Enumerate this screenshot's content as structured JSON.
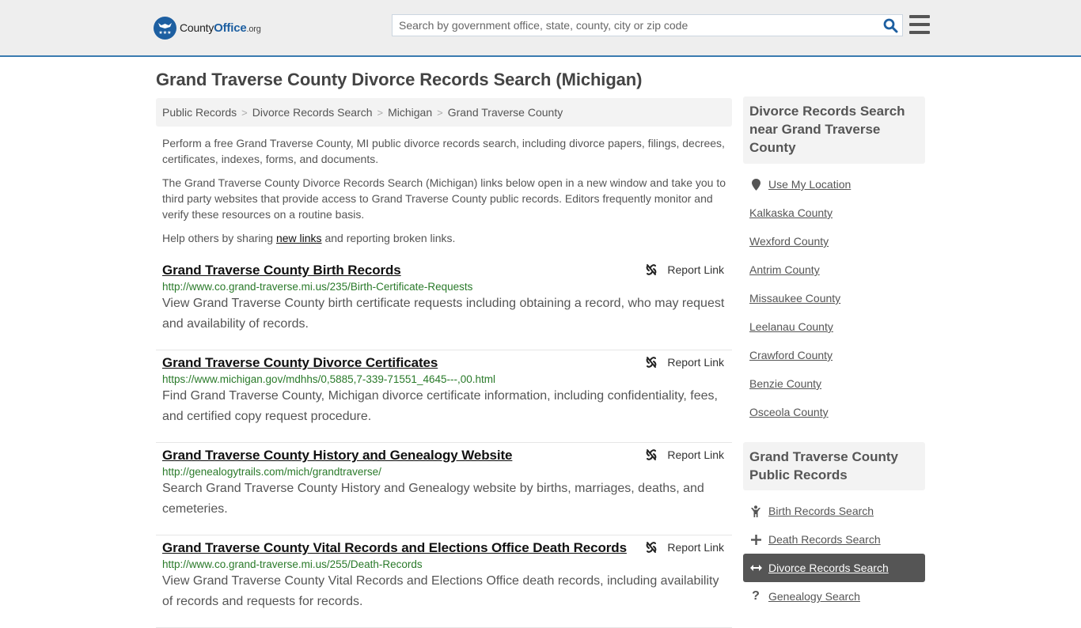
{
  "header": {
    "logo": {
      "name_part1": "County",
      "name_part2": "Office",
      "tld": ".org"
    },
    "search": {
      "placeholder": "Search by government office, state, county, city or zip code",
      "value": ""
    },
    "icons": {
      "search": "search-icon",
      "menu": "hamburger-menu-icon"
    }
  },
  "main": {
    "title": "Grand Traverse County Divorce Records Search (Michigan)",
    "breadcrumb": [
      "Public Records",
      "Divorce Records Search",
      "Michigan",
      "Grand Traverse County"
    ],
    "intro": {
      "p1": "Perform a free Grand Traverse County, MI public divorce records search, including divorce papers, filings, decrees, certificates, indexes, forms, and documents.",
      "p2": "The Grand Traverse County Divorce Records Search (Michigan) links below open in a new window and take you to third party websites that provide access to Grand Traverse County public records. Editors frequently monitor and verify these resources on a routine basis.",
      "p3_before": "Help others by sharing ",
      "p3_link": "new links",
      "p3_after": " and reporting broken links."
    },
    "report_label": "Report Link",
    "results": [
      {
        "title": "Grand Traverse County Birth Records",
        "url": "http://www.co.grand-traverse.mi.us/235/Birth-Certificate-Requests",
        "description": "View Grand Traverse County birth certificate requests including obtaining a record, who may request and availability of records."
      },
      {
        "title": "Grand Traverse County Divorce Certificates",
        "url": "https://www.michigan.gov/mdhhs/0,5885,7-339-71551_4645---,00.html",
        "description": "Find Grand Traverse County, Michigan divorce certificate information, including confidentiality, fees, and certified copy request procedure."
      },
      {
        "title": "Grand Traverse County History and Genealogy Website",
        "url": "http://genealogytrails.com/mich/grandtraverse/",
        "description": "Search Grand Traverse County History and Genealogy website by births, marriages, deaths, and cemeteries."
      },
      {
        "title": "Grand Traverse County Vital Records and Elections Office Death Records",
        "url": "http://www.co.grand-traverse.mi.us/255/Death-Records",
        "description": "View Grand Traverse County Vital Records and Elections Office death records, including availability of records and requests for records."
      }
    ]
  },
  "sidebar": {
    "nearby_heading": "Divorce Records Search near Grand Traverse County",
    "use_location": "Use My Location",
    "nearby": [
      "Kalkaska County",
      "Wexford County",
      "Antrim County",
      "Missaukee County",
      "Leelanau County",
      "Crawford County",
      "Benzie County",
      "Osceola County"
    ],
    "records_heading": "Grand Traverse County Public Records",
    "records": [
      {
        "label": "Birth Records Search",
        "icon": "child-icon",
        "active": false
      },
      {
        "label": "Death Records Search",
        "icon": "plus-icon",
        "active": false
      },
      {
        "label": "Divorce Records Search",
        "icon": "arrows-horizontal-icon",
        "active": true
      },
      {
        "label": "Genealogy Search",
        "icon": "question-icon",
        "active": false
      }
    ]
  },
  "colors": {
    "brand_blue": "#1d5fa1",
    "header_border": "#3a7bb0",
    "url_green": "#2a7a2a",
    "active_item_bg": "#555555"
  }
}
